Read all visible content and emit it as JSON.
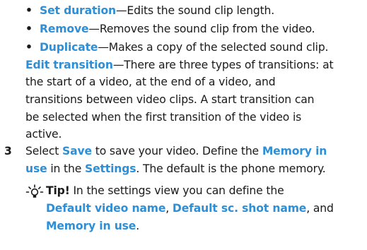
{
  "bullets": [
    {
      "bullet": "•",
      "keyword": "Set duration",
      "rest": "—Edits the sound clip length."
    },
    {
      "bullet": "•",
      "keyword": "Remove",
      "rest": "—Removes the sound clip from the video."
    },
    {
      "bullet": "•",
      "keyword": "Duplicate",
      "rest": "—Makes a copy of the selected sound clip."
    }
  ],
  "edit_transition": {
    "keyword": "Edit transition",
    "line1_rest": "—There are three types of transitions: at",
    "line2": "the start of a video, at the end of a video, and",
    "line3": "transitions between video clips. A start transition can",
    "line4": "be selected when the first transition of the video is",
    "line5": "active."
  },
  "step3": {
    "number": "3",
    "l1_a": "Select ",
    "l1_save": "Save",
    "l1_b": " to save your video. Define the ",
    "l1_memory": "Memory in",
    "l2_use": "use",
    "l2_a": " in the ",
    "l2_settings": "Settings",
    "l2_b": ". The default is the phone memory."
  },
  "tip": {
    "icon": "lightbulb-icon",
    "label": "Tip!",
    "l1_rest": " In the settings view you can define the",
    "l2_video_name": "Default video name",
    "l2_sep1": ", ",
    "l2_shot_name": "Default sc. shot name",
    "l2_sep2": ", and",
    "l3_memory": "Memory in use",
    "l3_end": "."
  },
  "colors": {
    "keyword": "#2f8fd6",
    "text": "#1a1a1a"
  }
}
